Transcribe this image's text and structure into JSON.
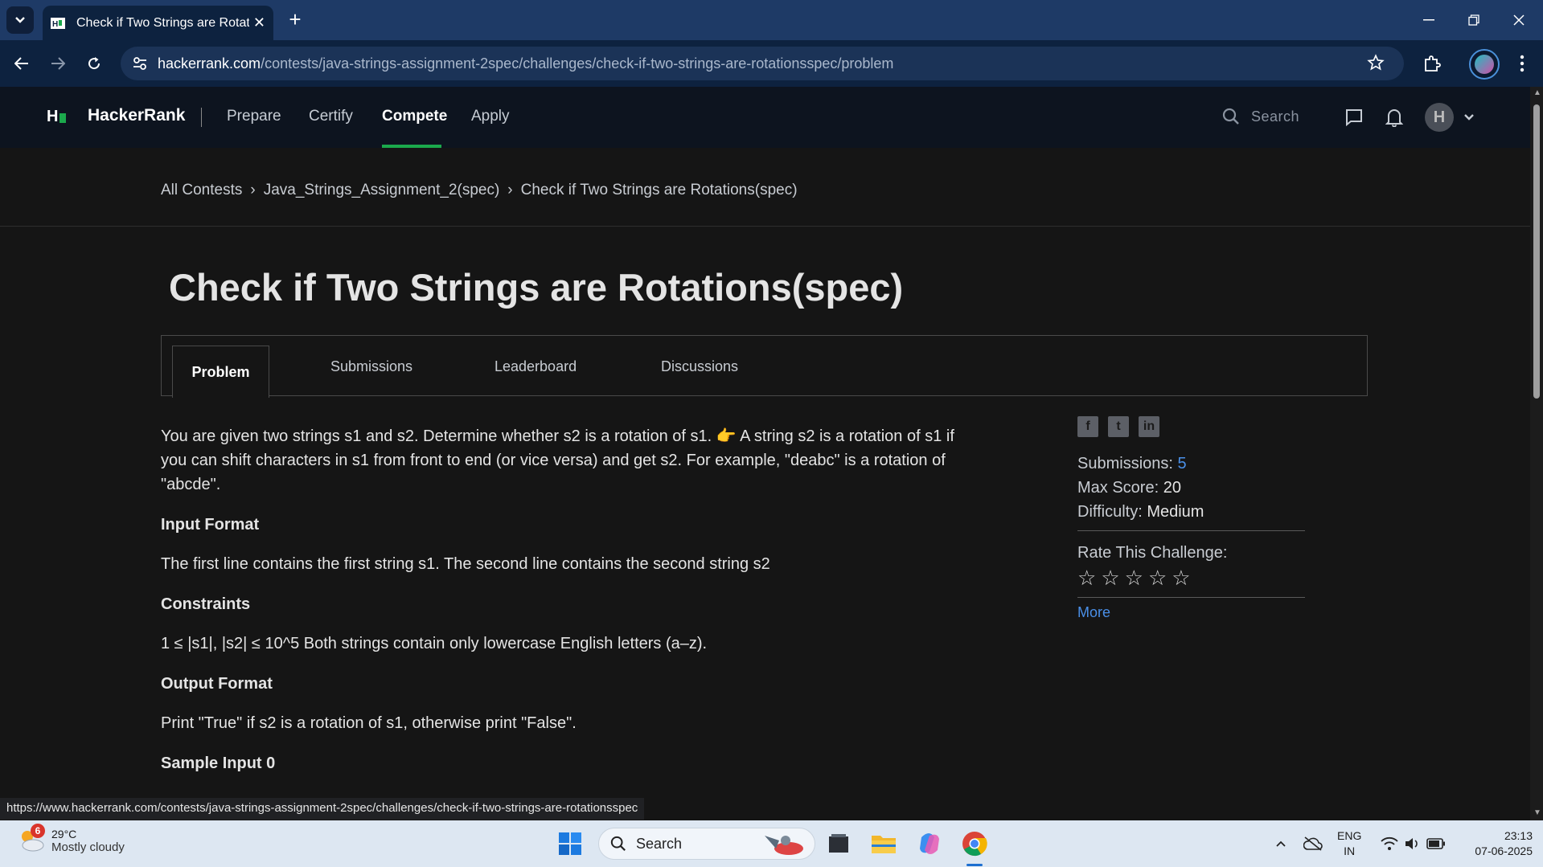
{
  "browser": {
    "tab_title": "Check if Two Strings are Rotatio",
    "url_host": "hackerrank.com",
    "url_path": "/contests/java-strings-assignment-2spec/challenges/check-if-two-strings-are-rotationsspec/problem"
  },
  "hr_nav": {
    "brand": "HackerRank",
    "links": [
      "Prepare",
      "Certify",
      "Compete",
      "Apply"
    ],
    "active": "Compete",
    "search_placeholder": "Search",
    "avatar_initial": "H"
  },
  "breadcrumb": [
    "All Contests",
    "Java_Strings_Assignment_2(spec)",
    "Check if Two Strings are Rotations(spec)"
  ],
  "title": "Check if Two Strings are Rotations(spec)",
  "tabs": [
    "Problem",
    "Submissions",
    "Leaderboard",
    "Discussions"
  ],
  "problem": {
    "intro": "You are given two strings s1 and s2. Determine whether s2 is a rotation of s1. 👉 A string s2 is a rotation of s1 if you can shift characters in s1 from front to end (or vice versa) and get s2. For example, \"deabc\" is a rotation of \"abcde\".",
    "input_heading": "Input Format",
    "input_text": "The first line contains the first string s1. The second line contains the second string s2",
    "constraints_heading": "Constraints",
    "constraints_text": "1 ≤ |s1|, |s2| ≤ 10^5 Both strings contain only lowercase English letters (a–z).",
    "output_heading": "Output Format",
    "output_text": "Print \"True\" if s2 is a rotation of s1, otherwise print \"False\".",
    "sample_heading": "Sample Input 0"
  },
  "sidebar": {
    "submissions_label": "Submissions:",
    "submissions_value": "5",
    "max_score_label": "Max Score:",
    "max_score_value": "20",
    "difficulty_label": "Difficulty:",
    "difficulty_value": "Medium",
    "rate_label": "Rate This Challenge:",
    "rating": 0,
    "more": "More"
  },
  "status_url": "https://www.hackerrank.com/contests/java-strings-assignment-2spec/challenges/check-if-two-strings-are-rotationsspec",
  "taskbar": {
    "weather_badge": "6",
    "temperature": "29°C",
    "weather_desc": "Mostly cloudy",
    "search_label": "Search",
    "lang_top": "ENG",
    "lang_bottom": "IN",
    "time": "23:13",
    "date": "07-06-2025"
  },
  "colors": {
    "accent_green": "#1ba94c",
    "link_blue": "#4a8fe7",
    "chrome_blue": "#0d223f"
  }
}
